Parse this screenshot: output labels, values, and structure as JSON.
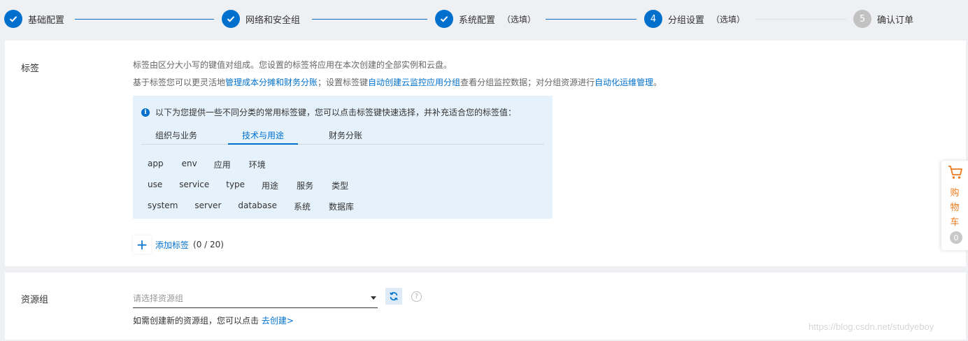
{
  "stepper": {
    "steps": [
      {
        "title": "基础配置",
        "status": "done"
      },
      {
        "title": "网络和安全组",
        "status": "done"
      },
      {
        "title": "系统配置",
        "optional": "（选填）",
        "status": "done"
      },
      {
        "number": "4",
        "title": "分组设置",
        "optional": "（选填）",
        "status": "active"
      },
      {
        "number": "5",
        "title": "确认订单",
        "status": "pending"
      }
    ]
  },
  "tags_section": {
    "label": "标签",
    "desc1": "标签由区分大小写的键值对组成。您设置的标签将应用在本次创建的全部实例和云盘。",
    "desc2_prefix": "基于标签您可以更灵活地",
    "desc2_link1": "管理成本分摊和财务分账",
    "desc2_mid1": "；设置标签键",
    "desc2_link2": "自动创建云监控应用分组",
    "desc2_mid2": "查看分组监控数据；对分组资源进行",
    "desc2_link3": "自动化运维管理",
    "desc2_suffix": "。",
    "hint": "以下为您提供一些不同分类的常用标签键，您可以点击标签键快速选择，并补充适合您的标签值：",
    "tabs": [
      "组织与业务",
      "技术与用途",
      "财务分账"
    ],
    "active_tab": "技术与用途",
    "tag_rows": [
      [
        "app",
        "env",
        "应用",
        "环境"
      ],
      [
        "use",
        "service",
        "type",
        "用途",
        "服务",
        "类型"
      ],
      [
        "system",
        "server",
        "database",
        "系统",
        "数据库"
      ]
    ],
    "add_tag_label": "添加标签",
    "add_tag_count": "(0 / 20)"
  },
  "resource_group": {
    "label": "资源组",
    "placeholder": "请选择资源组",
    "hint_prefix": "如需创建新的资源组，您可以点击 ",
    "hint_link": "去创建>"
  },
  "cart": {
    "label_chars": [
      "购",
      "物",
      "车"
    ],
    "count": "0"
  },
  "watermark": "https://blog.csdn.net/studyeboy",
  "colors": {
    "accent": "#0070cc",
    "cart": "#f07b1d",
    "pending": "#c2c2c2",
    "hint_bg": "#e6f2fb"
  }
}
